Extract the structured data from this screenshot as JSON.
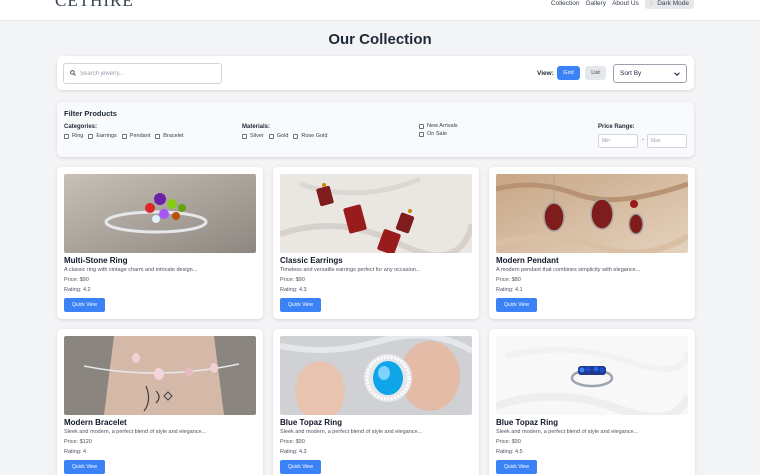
{
  "header": {
    "logo": "CETHIRE",
    "nav": [
      "Collection",
      "Gallery",
      "About Us"
    ],
    "dark_mode_label": "Dark Mode"
  },
  "page_title": "Our Collection",
  "search": {
    "placeholder": "Search jewelry...",
    "value": ""
  },
  "view": {
    "label": "View:",
    "grid_label": "Grid",
    "list_label": "List",
    "active": "Grid"
  },
  "sort": {
    "selected": "Sort By"
  },
  "filters": {
    "title": "Filter Products",
    "categories_label": "Categories:",
    "categories": [
      "Ring",
      "Earrings",
      "Pendant",
      "Bracelet"
    ],
    "materials_label": "Materials:",
    "materials": [
      "Silver",
      "Gold",
      "Rose Gold"
    ],
    "flags": [
      "New Arrivals",
      "On Sale"
    ],
    "price_label": "Price Range:",
    "min_placeholder": "Min",
    "max_placeholder": "Max",
    "separator": "-"
  },
  "products": [
    {
      "name": "Multi-Stone Ring",
      "desc": "A classic ring with vintage charm and intricate design...",
      "price": "Price: $90",
      "rating": "Rating: 4.2",
      "button": "Quick View"
    },
    {
      "name": "Classic Earrings",
      "desc": "Timeless and versatile earrings perfect for any occasion...",
      "price": "Price: $90",
      "rating": "Rating: 4.3",
      "button": "Quick View"
    },
    {
      "name": "Modern Pendant",
      "desc": "A modern pendant that combines simplicity with elegance...",
      "price": "Price: $80",
      "rating": "Rating: 4.1",
      "button": "Quick View"
    },
    {
      "name": "Modern Bracelet",
      "desc": "Sleek and modern, a perfect blend of style and elegance...",
      "price": "Price: $120",
      "rating": "Rating: 4",
      "button": "Quick View"
    },
    {
      "name": "Blue Topaz Ring",
      "desc": "Sleek and modern, a perfect blend of style and elegance...",
      "price": "Price: $90",
      "rating": "Rating: 4.3",
      "button": "Quick View"
    },
    {
      "name": "Blue Topaz Ring",
      "desc": "Sleek and modern, a perfect blend of style and elegance...",
      "price": "Price: $90",
      "rating": "Rating: 4.5",
      "button": "Quick View"
    }
  ],
  "colors": {
    "accent": "#3b82f6",
    "background": "#f3f4f6"
  }
}
